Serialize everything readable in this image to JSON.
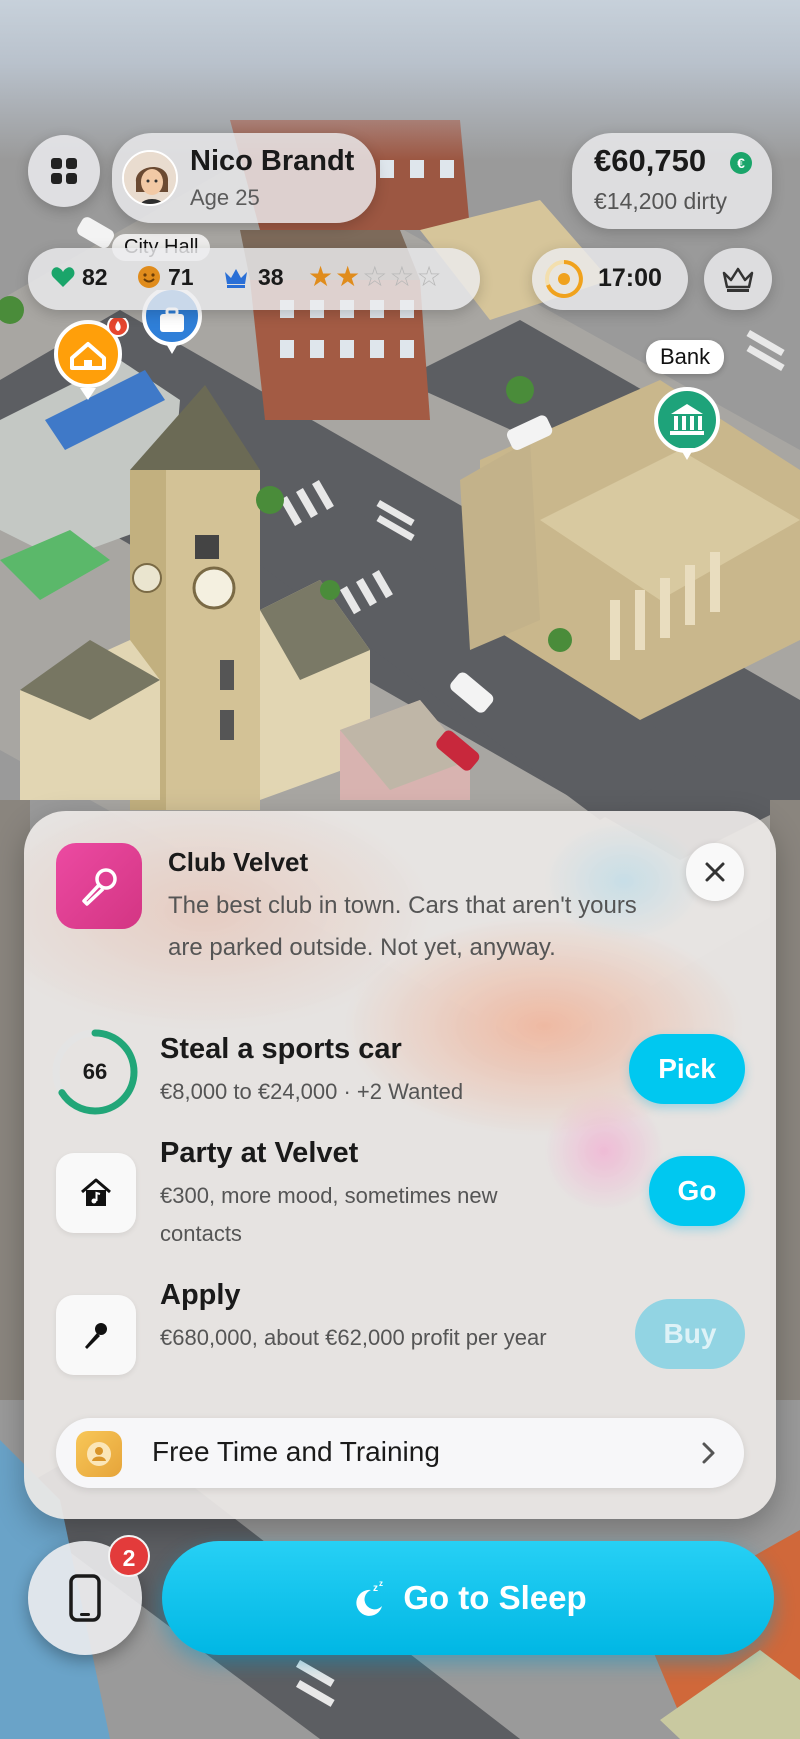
{
  "player": {
    "name": "Nico Brandt",
    "age": "Age 25"
  },
  "money": {
    "clean": "€60,750",
    "currency_icon": "€",
    "dirty": "€14,200 dirty"
  },
  "stats": {
    "health": "82",
    "mood": "71",
    "reputation": "38",
    "wanted_level": 2,
    "wanted_max": 5,
    "time": "17:00"
  },
  "map": {
    "bank_label": "Bank",
    "city_hall_label": "City Hall"
  },
  "venue": {
    "title": "Club Velvet",
    "description": "The best club in town. Cars that aren't yours are parked outside. Not yet, anyway."
  },
  "actions": [
    {
      "chance": "66",
      "chance_fraction": 0.66,
      "title": "Steal a sports car",
      "subtitle": "€8,000 to €24,000 · +2 Wanted",
      "button": "Pick"
    },
    {
      "title": "Party at Velvet",
      "subtitle": "€300, more mood, sometimes new contacts",
      "button": "Go"
    },
    {
      "title": "Apply",
      "subtitle": "€680,000, about €62,000 profit per year",
      "button": "Buy",
      "disabled": true
    }
  ],
  "free_time": {
    "label": "Free Time and Training"
  },
  "bottom": {
    "notifications": "2",
    "sleep_label": "Go to Sleep"
  },
  "colors": {
    "accent": "#00c8f0",
    "club_icon": "#e0418f",
    "health": "#1aa56a",
    "mood": "#e08c1c",
    "reputation": "#2a6fd6",
    "star": "#e08c1c",
    "badge": "#e33b3b"
  }
}
